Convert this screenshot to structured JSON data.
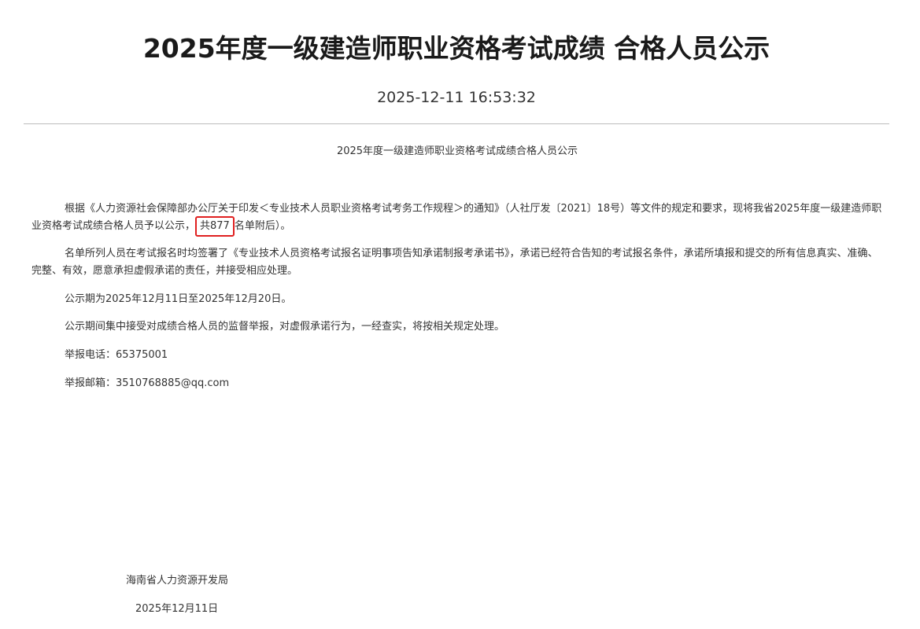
{
  "header": {
    "title": "2025年度一级建造师职业资格考试成绩 合格人员公示",
    "datetime": "2025-12-11 16:53:32"
  },
  "article": {
    "subtitle": "2025年度一级建造师职业资格考试成绩合格人员公示",
    "p1_before": "根据《人力资源社会保障部办公厅关于印发＜专业技术人员职业资格考试考务工作规程＞的通知》（人社厅发〔2021〕18号）等文件的规定和要求，现将我省2025年度一级建造师职业资格考试成绩合格人员予以公示，",
    "p1_highlight": "共877",
    "p1_after": "名单附后）。",
    "p2": "名单所列人员在考试报名时均签署了《专业技术人员资格考试报名证明事项告知承诺制报考承诺书》，承诺已经符合告知的考试报名条件，承诺所填报和提交的所有信息真实、准确、完整、有效，愿意承担虚假承诺的责任，并接受相应处理。",
    "p3": "公示期为2025年12月11日至2025年12月20日。",
    "p4": "公示期间集中接受对成绩合格人员的监督举报，对虚假承诺行为，一经查实，将按相关规定处理。",
    "p5": "举报电话：65375001",
    "p6": "举报邮箱：3510768885@qq.com"
  },
  "signature": {
    "org": "海南省人力资源开发局",
    "date": "2025年12月11日"
  },
  "colors": {
    "highlight_border": "#e02020",
    "text": "#333333",
    "title": "#1a1a1a",
    "divider": "#bbbbbb"
  }
}
